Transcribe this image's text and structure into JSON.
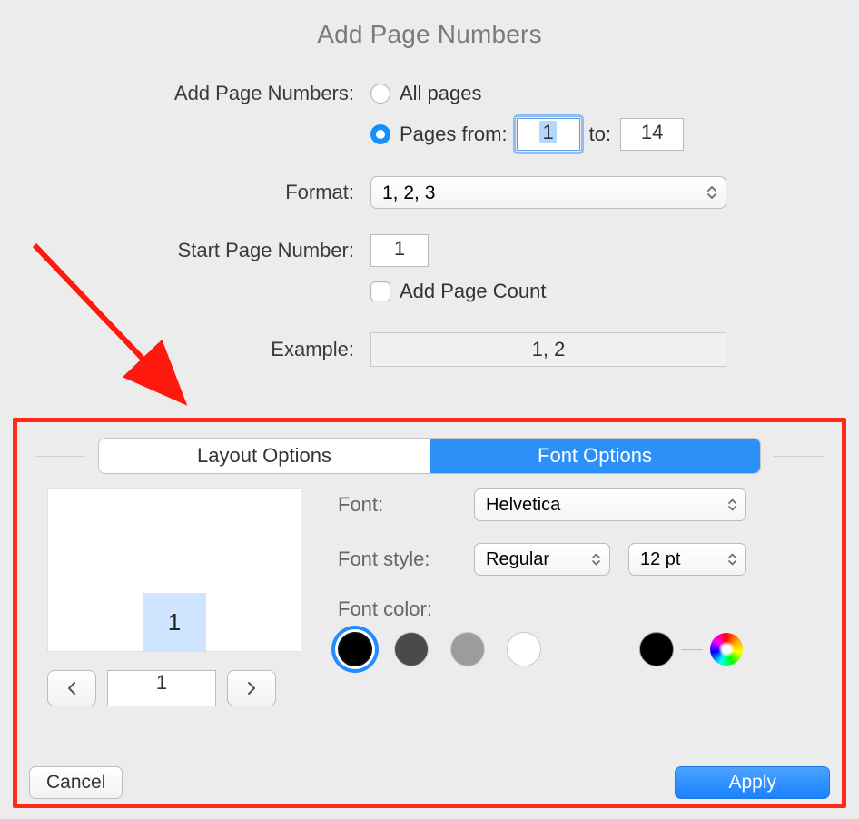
{
  "title": "Add Page Numbers",
  "labels": {
    "add_scope": "Add Page Numbers:",
    "format": "Format:",
    "start_num": "Start Page Number:",
    "example": "Example:",
    "font": "Font:",
    "font_style": "Font style:",
    "font_color": "Font color:"
  },
  "radios": {
    "all_pages": "All pages",
    "pages_from": "Pages from:",
    "to": "to:"
  },
  "values": {
    "from": "1",
    "to": "14",
    "format_selected": "1, 2, 3",
    "start": "1",
    "example": "1, 2",
    "preview_page_num": "1",
    "pager_value": "1",
    "font_selected": "Helvetica",
    "style_selected": "Regular",
    "size_selected": "12 pt"
  },
  "checkbox": {
    "add_page_count": "Add Page Count"
  },
  "tabs": {
    "layout": "Layout Options",
    "font": "Font Options"
  },
  "buttons": {
    "cancel": "Cancel",
    "apply": "Apply"
  }
}
